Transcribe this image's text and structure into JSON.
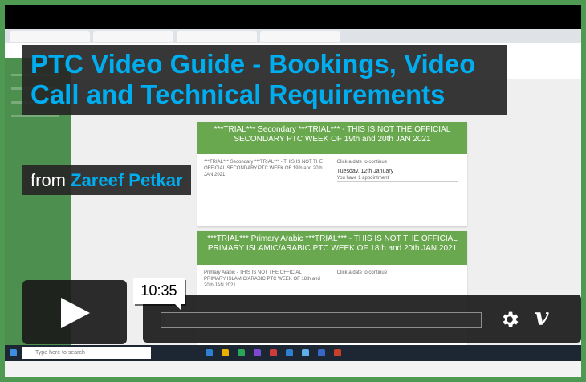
{
  "video": {
    "title": "PTC Video Guide - Bookings, Video Call and Technical Requirements",
    "byline_prefix": "from",
    "author": "Zareef Petkar",
    "current_time": "10:35"
  },
  "background_screen": {
    "card1": {
      "header": "***TRIAL*** Secondary ***TRIAL*** - THIS IS NOT THE OFFICIAL SECONDARY PTC WEEK OF 19th and 20th JAN 2021",
      "desc": "***TRIAL*** Secondary ***TRIAL*** - THIS IS NOT THE OFFICIAL SECONDARY PTC WEEK OF 19th and 20th JAN 2021",
      "prompt": "Click a date to continue",
      "date": "Tuesday, 12th January",
      "sub": "You have 1 appointment"
    },
    "card2": {
      "header": "***TRIAL*** Primary Arabic ***TRIAL*** - THIS IS NOT THE OFFICIAL PRIMARY ISLAMIC/ARABIC PTC WEEK OF 18th and 20th JAN 2021",
      "desc": "Primary Arabic - THIS IS NOT THE OFFICIAL PRIMARY ISLAMIC/ARABIC PTC WEEK OF 18th and 20th JAN 2021",
      "prompt": "Click a date to continue"
    },
    "taskbar_search": "Type here to search"
  },
  "colors": {
    "accent": "#00adef",
    "frame": "#4f9a52",
    "card_header": "#6aa84f",
    "overlay": "#262626"
  },
  "icons": [
    "play-icon",
    "gear-icon",
    "vimeo-logo"
  ]
}
